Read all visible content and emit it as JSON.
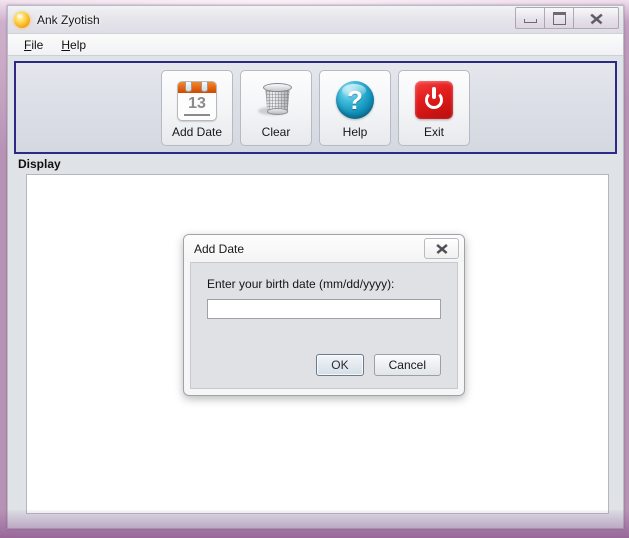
{
  "window": {
    "title": "Ank Zyotish",
    "icon": "sun-icon",
    "controls": {
      "minimize": "minimize-icon",
      "maximize": "maximize-icon",
      "close": "close-icon"
    }
  },
  "menubar": {
    "items": [
      {
        "label": "File",
        "mnemonic": "F"
      },
      {
        "label": "Help",
        "mnemonic": "H"
      }
    ]
  },
  "toolbar": {
    "buttons": [
      {
        "label": "Add Date",
        "icon": "calendar-icon",
        "icon_text": "13"
      },
      {
        "label": "Clear",
        "icon": "trash-can-icon"
      },
      {
        "label": "Help",
        "icon": "question-mark-icon",
        "icon_text": "?"
      },
      {
        "label": "Exit",
        "icon": "power-icon"
      }
    ],
    "border_color": "#2b2b86"
  },
  "display": {
    "label": "Display",
    "content": ""
  },
  "dialog": {
    "title": "Add Date",
    "close_icon": "close-icon",
    "prompt": "Enter your birth date (mm/dd/yyyy):",
    "input_value": "",
    "input_placeholder": "",
    "ok_label": "OK",
    "cancel_label": "Cancel"
  },
  "theme": {
    "accent": "#2b2b86",
    "exit_red": "#e21c1c",
    "help_blue": "#1191bb",
    "calendar_orange": "#e4620f",
    "glass_purple": "#b88fb6"
  }
}
